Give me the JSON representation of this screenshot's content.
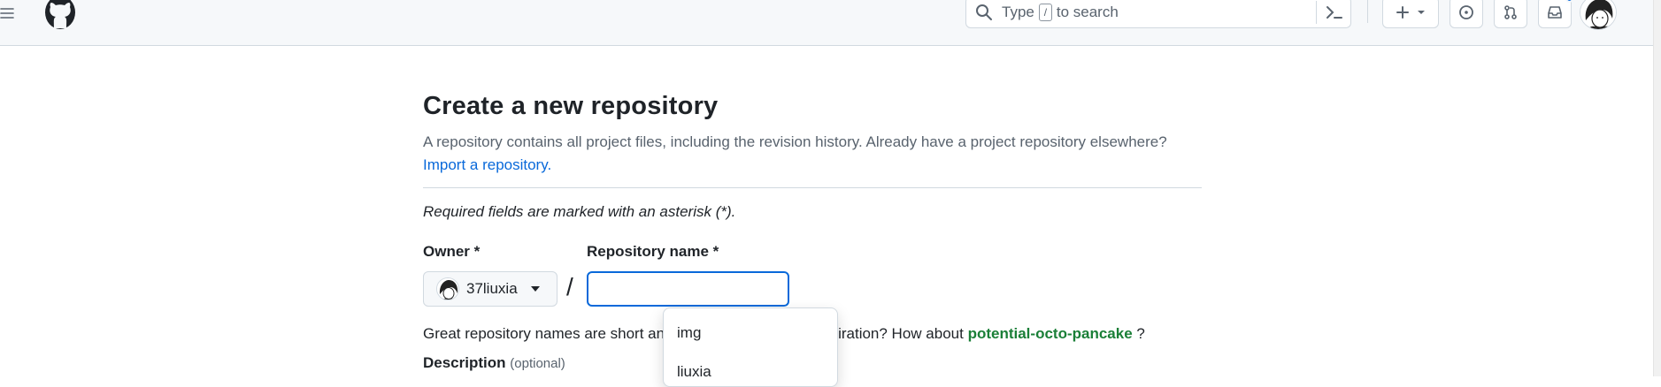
{
  "header": {
    "search_placeholder_pre": "Type",
    "search_shortcut": "/",
    "search_placeholder_post": "to search"
  },
  "main": {
    "title": "Create a new repository",
    "intro_text": "A repository contains all project files, including the revision history. Already have a project repository elsewhere?",
    "import_link": "Import a repository.",
    "required_note": "Required fields are marked with an asterisk (*).",
    "owner_label": "Owner *",
    "owner_value": "37liuxia",
    "separator": "/",
    "repo_label": "Repository name *",
    "repo_value": "",
    "hint_text": "Great repository names are short an",
    "hint_text_after": "iration? How about",
    "suggestion": "potential-octo-pancake",
    "hint_end": "?",
    "description_label": "Description",
    "description_optional": "(optional)"
  },
  "autocomplete": {
    "items": [
      "img",
      "liuxia"
    ]
  },
  "colors": {
    "accent": "#0969da",
    "suggestion_green": "#1a7f37",
    "header_bg": "#f6f8fa"
  },
  "icons": [
    "hamburger-icon",
    "github-logo-icon",
    "search-icon",
    "command-palette-icon",
    "plus-icon",
    "chevron-down-icon",
    "issues-icon",
    "pull-request-icon",
    "inbox-icon",
    "caret-down-icon"
  ]
}
